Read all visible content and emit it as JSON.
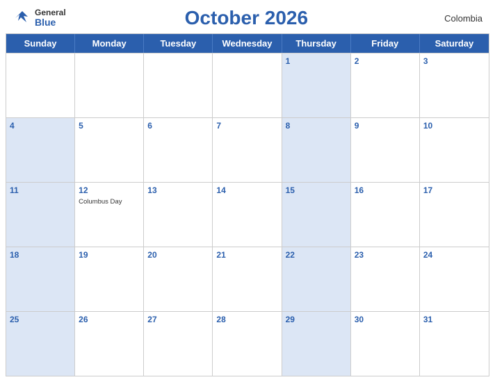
{
  "header": {
    "logo_general": "General",
    "logo_blue": "Blue",
    "title": "October 2026",
    "country": "Colombia"
  },
  "days": {
    "headers": [
      "Sunday",
      "Monday",
      "Tuesday",
      "Wednesday",
      "Thursday",
      "Friday",
      "Saturday"
    ]
  },
  "weeks": [
    [
      {
        "number": "",
        "event": "",
        "blue": false
      },
      {
        "number": "",
        "event": "",
        "blue": false
      },
      {
        "number": "",
        "event": "",
        "blue": false
      },
      {
        "number": "",
        "event": "",
        "blue": false
      },
      {
        "number": "1",
        "event": "",
        "blue": true
      },
      {
        "number": "2",
        "event": "",
        "blue": false
      },
      {
        "number": "3",
        "event": "",
        "blue": false
      }
    ],
    [
      {
        "number": "4",
        "event": "",
        "blue": true
      },
      {
        "number": "5",
        "event": "",
        "blue": false
      },
      {
        "number": "6",
        "event": "",
        "blue": false
      },
      {
        "number": "7",
        "event": "",
        "blue": false
      },
      {
        "number": "8",
        "event": "",
        "blue": true
      },
      {
        "number": "9",
        "event": "",
        "blue": false
      },
      {
        "number": "10",
        "event": "",
        "blue": false
      }
    ],
    [
      {
        "number": "11",
        "event": "",
        "blue": true
      },
      {
        "number": "12",
        "event": "Columbus Day",
        "blue": false
      },
      {
        "number": "13",
        "event": "",
        "blue": false
      },
      {
        "number": "14",
        "event": "",
        "blue": false
      },
      {
        "number": "15",
        "event": "",
        "blue": true
      },
      {
        "number": "16",
        "event": "",
        "blue": false
      },
      {
        "number": "17",
        "event": "",
        "blue": false
      }
    ],
    [
      {
        "number": "18",
        "event": "",
        "blue": true
      },
      {
        "number": "19",
        "event": "",
        "blue": false
      },
      {
        "number": "20",
        "event": "",
        "blue": false
      },
      {
        "number": "21",
        "event": "",
        "blue": false
      },
      {
        "number": "22",
        "event": "",
        "blue": true
      },
      {
        "number": "23",
        "event": "",
        "blue": false
      },
      {
        "number": "24",
        "event": "",
        "blue": false
      }
    ],
    [
      {
        "number": "25",
        "event": "",
        "blue": true
      },
      {
        "number": "26",
        "event": "",
        "blue": false
      },
      {
        "number": "27",
        "event": "",
        "blue": false
      },
      {
        "number": "28",
        "event": "",
        "blue": false
      },
      {
        "number": "29",
        "event": "",
        "blue": true
      },
      {
        "number": "30",
        "event": "",
        "blue": false
      },
      {
        "number": "31",
        "event": "",
        "blue": false
      }
    ]
  ]
}
